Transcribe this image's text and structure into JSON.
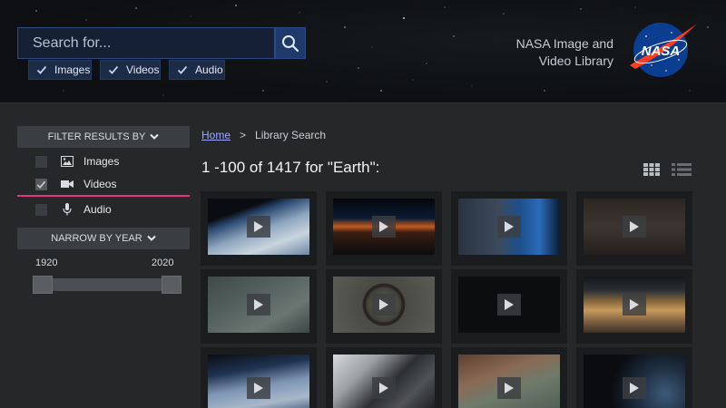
{
  "header": {
    "search": {
      "placeholder": "Search for..."
    },
    "media_filters": [
      {
        "label": "Images",
        "checked": true
      },
      {
        "label": "Videos",
        "checked": true
      },
      {
        "label": "Audio",
        "checked": true
      }
    ],
    "brand": {
      "line1": "NASA Image and",
      "line2": "Video Library",
      "logo_text": "NASA"
    }
  },
  "sidebar": {
    "filter_title": "FILTER RESULTS BY",
    "filters": [
      {
        "label": "Images",
        "icon": "image-icon",
        "checked": false
      },
      {
        "label": "Videos",
        "icon": "video-camera-icon",
        "checked": true
      },
      {
        "label": "Audio",
        "icon": "microphone-icon",
        "checked": false
      }
    ],
    "narrow_title": "NARROW BY YEAR",
    "year_min": "1920",
    "year_max": "2020"
  },
  "main": {
    "breadcrumb": {
      "home": "Home",
      "separator": ">",
      "current": "Library Search"
    },
    "results_count": "1 -100 of 1417 for \"Earth\":"
  },
  "colors": {
    "accent_pink": "#e3357c",
    "search_blue": "#1e3a6c",
    "link": "#9aa9ff",
    "logo_blue": "#0b3d91",
    "logo_red": "#fc3d21"
  },
  "icons": {
    "search": "search-icon",
    "grid_view": "grid-view-icon",
    "list_view": "list-view-icon",
    "play": "play-icon",
    "chevron": "chevron-down-icon"
  }
}
